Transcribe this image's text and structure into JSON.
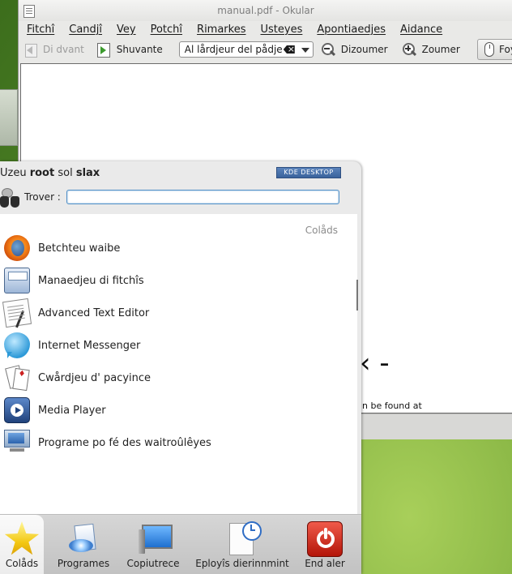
{
  "window": {
    "title": "manual.pdf - Okular"
  },
  "menubar": {
    "items": [
      "Fitchî",
      "Candjî",
      "Vey",
      "Potchî",
      "Rimarkes",
      "Usteyes",
      "Apontiaedjes",
      "Aidance"
    ]
  },
  "toolbar": {
    "back_label": "Di dvant",
    "next_label": "Shuvante",
    "zoom_value": "Al lårdjeur del pådje",
    "zoom_out_label": "Dizoumer",
    "zoom_in_label": "Zoumer",
    "browse_label": "Foy"
  },
  "document": {
    "visible_glyph": "‹ -",
    "visible_text": "n be found at"
  },
  "kickoff": {
    "user_prefix": "Uzeu",
    "user_name": "root",
    "host_prefix": "sol",
    "host_name": "slax",
    "logo_text": "KDE DESKTOP",
    "search_label": "Trover :",
    "search_value": "",
    "section_title": "Colåds",
    "favorites": [
      {
        "label": "Betchteu waibe",
        "icon": "firefox-icon"
      },
      {
        "label": "Manaedjeu di fitchîs",
        "icon": "file-manager-icon"
      },
      {
        "label": "Advanced Text Editor",
        "icon": "text-editor-icon"
      },
      {
        "label": "Internet Messenger",
        "icon": "messenger-icon"
      },
      {
        "label": "Cwårdjeu d' pacyince",
        "icon": "cards-icon"
      },
      {
        "label": "Media Player",
        "icon": "media-player-icon"
      },
      {
        "label": "Programe po fé des waitroûlêyes",
        "icon": "computer-icon"
      }
    ],
    "tabs": [
      {
        "label": "Colåds",
        "icon": "star-icon",
        "active": true
      },
      {
        "label": "Programes",
        "icon": "programs-icon",
        "active": false
      },
      {
        "label": "Copiutrece",
        "icon": "computer-icon",
        "active": false
      },
      {
        "label": "Eployîs dierinnmint",
        "icon": "recent-clock-icon",
        "active": false
      },
      {
        "label": "End aler",
        "icon": "power-icon",
        "active": false
      }
    ]
  }
}
